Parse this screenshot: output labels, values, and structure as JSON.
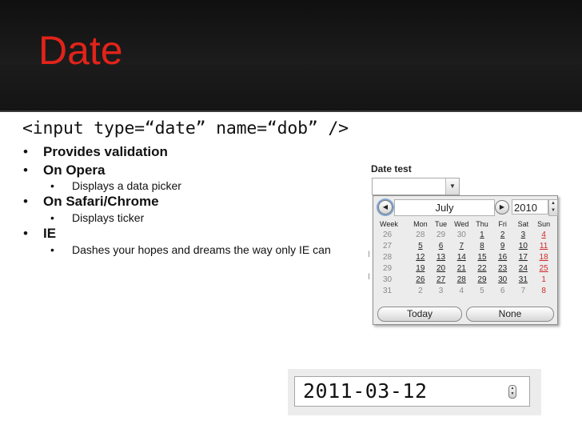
{
  "slide": {
    "title": "Date",
    "code": "<input type=“date” name=“dob” />",
    "bullets": [
      {
        "text": "Provides validation",
        "level": 1
      },
      {
        "text": "On Opera",
        "level": 1
      },
      {
        "text": "Displays a data picker",
        "level": 2
      },
      {
        "text": "On Safari/Chrome",
        "level": 1
      },
      {
        "text": "Displays ticker",
        "level": 2
      },
      {
        "text": "IE",
        "level": 1
      },
      {
        "text": "Dashes your hopes and dreams the way only IE can",
        "level": 2
      }
    ]
  },
  "opera_picker": {
    "label": "Date test",
    "month": "July",
    "year": "2010",
    "header": [
      "Week",
      "Mon",
      "Tue",
      "Wed",
      "Thu",
      "Fri",
      "Sat",
      "Sun"
    ],
    "weeks": [
      {
        "week": "26",
        "days": [
          "28",
          "29",
          "30",
          "1",
          "2",
          "3",
          "4"
        ]
      },
      {
        "week": "27",
        "days": [
          "5",
          "6",
          "7",
          "8",
          "9",
          "10",
          "11"
        ]
      },
      {
        "week": "28",
        "days": [
          "12",
          "13",
          "14",
          "15",
          "16",
          "17",
          "18"
        ]
      },
      {
        "week": "29",
        "days": [
          "19",
          "20",
          "21",
          "22",
          "23",
          "24",
          "25"
        ]
      },
      {
        "week": "30",
        "days": [
          "26",
          "27",
          "28",
          "29",
          "30",
          "31",
          "1"
        ]
      },
      {
        "week": "31",
        "days": [
          "2",
          "3",
          "4",
          "5",
          "6",
          "7",
          "8"
        ]
      }
    ],
    "today_label": "Today",
    "none_label": "None"
  },
  "safari_ticker": {
    "value": "2011-03-12"
  }
}
